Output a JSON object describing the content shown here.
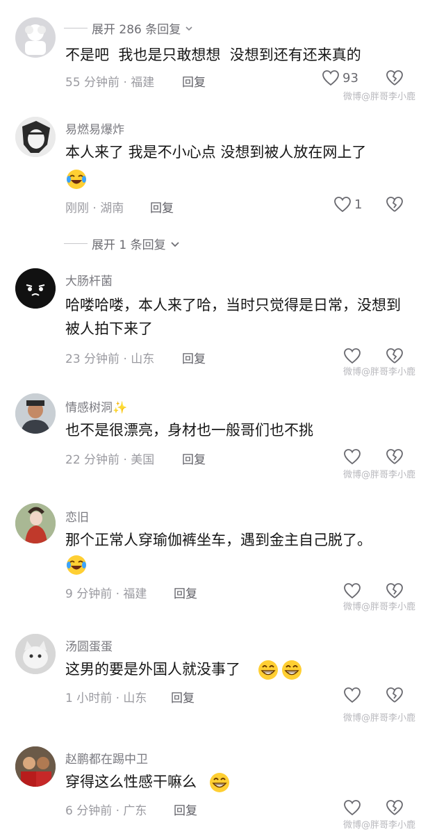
{
  "top_expand": {
    "label": "展开 286 条回复"
  },
  "comments": [
    {
      "name": "",
      "text": "不是吧  我也是只敢想想  没想到还有还来真的",
      "time": "55 分钟前 · 福建",
      "reply": "回复",
      "likes": "93"
    },
    {
      "name": "易燃易爆炸",
      "text": "本人来了 我是不小心点 没想到被人放在网上了",
      "time": "刚刚 · 湖南",
      "reply": "回复",
      "likes": "1",
      "emoji": "laugh-cry"
    },
    {
      "name": "大肠杆菌",
      "text": "哈喽哈喽，本人来了哈，当时只觉得是日常，没想到被人拍下来了",
      "time": "23 分钟前 · 山东",
      "reply": "回复",
      "likes": ""
    },
    {
      "name": "情感树洞✨",
      "text": "也不是很漂亮，身材也一般哥们也不挑",
      "time": "22 分钟前 · 美国",
      "reply": "回复",
      "likes": ""
    },
    {
      "name": "恋旧",
      "text": "那个正常人穿瑜伽裤坐车，遇到金主自己脱了。",
      "time": "9 分钟前 · 福建",
      "reply": "回复",
      "likes": "",
      "emoji": "laugh-cry"
    },
    {
      "name": "汤圆蛋蛋",
      "text": "这男的要是外国人就没事了",
      "time": "1 小时前 · 山东",
      "reply": "回复",
      "likes": "",
      "emoji": "grin-grin"
    },
    {
      "name": "赵鹏都在踢中卫",
      "text": "穿得这么性感干嘛么",
      "time": "6 分钟前 · 广东",
      "reply": "回复",
      "likes": "",
      "emoji": "grin"
    }
  ],
  "mid_expand": {
    "label": "展开 1 条回复"
  },
  "watermark": "微博@胖哥李小鹿",
  "icons": {
    "like": "heart-outline-icon",
    "dislike": "broken-heart-icon",
    "expand": "chevron-down-icon"
  }
}
